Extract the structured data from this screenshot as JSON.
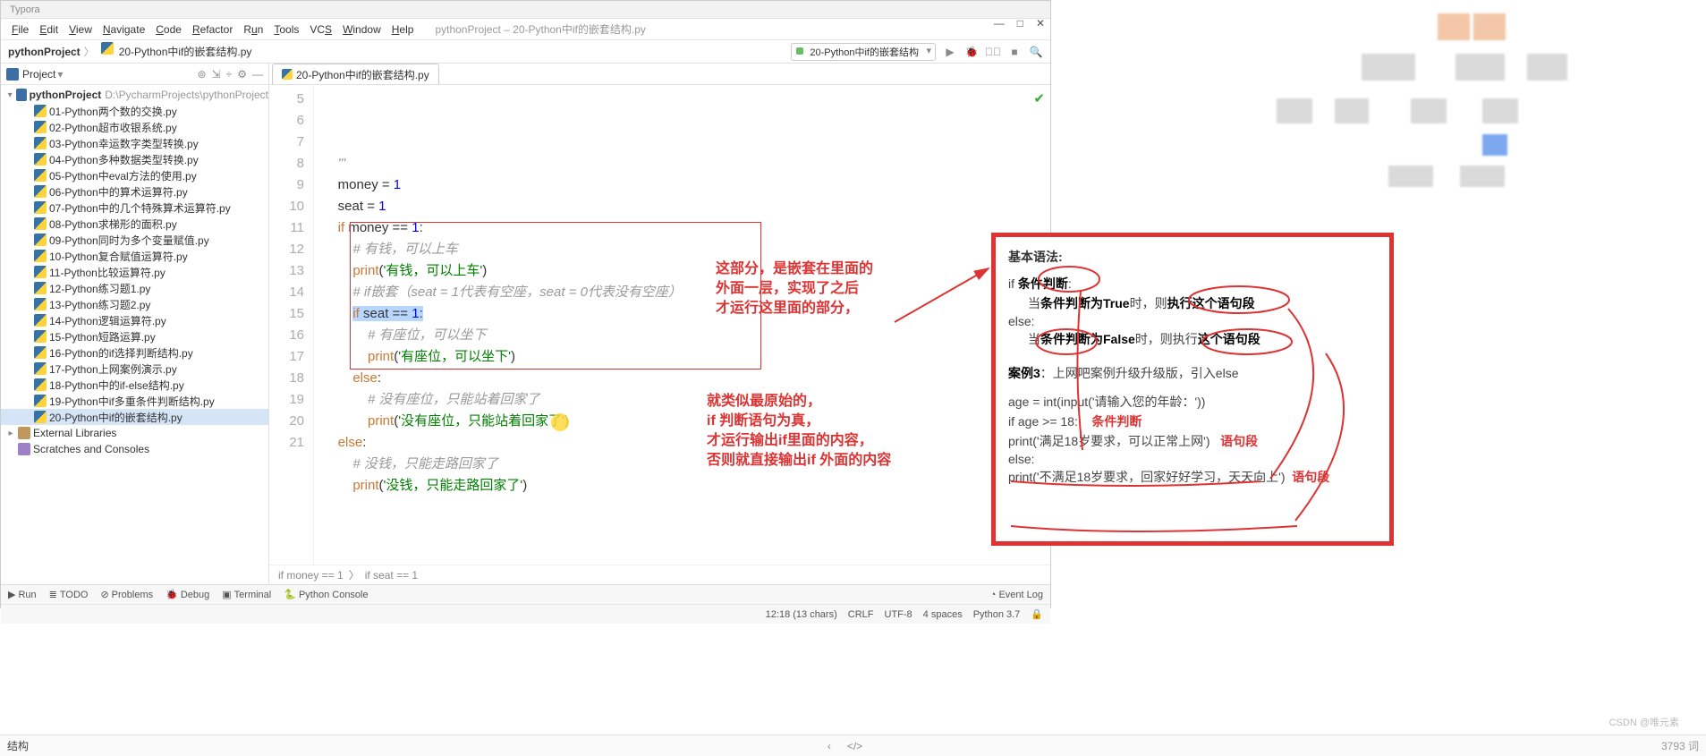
{
  "window": {
    "app_hint": "Typora",
    "title": "pythonProject – 20-Python中if的嵌套结构.py",
    "min": "—",
    "max": "□",
    "close": "✕"
  },
  "menu": [
    "File",
    "Edit",
    "View",
    "Navigate",
    "Code",
    "Refactor",
    "Run",
    "Tools",
    "VCS",
    "Window",
    "Help"
  ],
  "breadcrumb": {
    "project": "pythonProject",
    "file": "20-Python中if的嵌套结构.py"
  },
  "run_config": "20-Python中if的嵌套结构",
  "project_tool": {
    "title": "Project",
    "root": "pythonProject",
    "root_path": "D:\\PycharmProjects\\pythonProject",
    "files": [
      "01-Python两个数的交换.py",
      "02-Python超市收银系统.py",
      "03-Python幸运数字类型转换.py",
      "04-Python多种数据类型转换.py",
      "05-Python中eval方法的使用.py",
      "06-Python中的算术运算符.py",
      "07-Python中的几个特殊算术运算符.py",
      "08-Python求梯形的面积.py",
      "09-Python同时为多个变量赋值.py",
      "10-Python复合赋值运算符.py",
      "11-Python比较运算符.py",
      "12-Python练习题1.py",
      "13-Python练习题2.py",
      "14-Python逻辑运算符.py",
      "15-Python短路运算.py",
      "16-Python的if选择判断结构.py",
      "17-Python上网案例演示.py",
      "18-Python中的if-else结构.py",
      "19-Python中if多重条件判断结构.py",
      "20-Python中if的嵌套结构.py"
    ],
    "extras": [
      "External Libraries",
      "Scratches and Consoles"
    ],
    "selected_index": 19
  },
  "tab": {
    "label": "20-Python中if的嵌套结构.py"
  },
  "code": {
    "first_line_no": 5,
    "lines": [
      {
        "n": 5,
        "t": "    '''",
        "c": "cmt"
      },
      {
        "n": 6,
        "t": "    money = 1"
      },
      {
        "n": 7,
        "t": "    seat = 1"
      },
      {
        "n": 8,
        "t": "    if money == 1:"
      },
      {
        "n": 9,
        "t": "        # 有钱，可以上车",
        "c": "cmt"
      },
      {
        "n": 10,
        "t": "        print('有钱，可以上车')"
      },
      {
        "n": 11,
        "t": "        # if嵌套（seat = 1代表有空座，seat = 0代表没有空座）",
        "c": "cmt"
      },
      {
        "n": 12,
        "t": "        if seat == 1:",
        "hl": true,
        "sel": [
          8,
          22
        ]
      },
      {
        "n": 13,
        "t": "            # 有座位，可以坐下",
        "c": "cmt"
      },
      {
        "n": 14,
        "t": "            print('有座位，可以坐下')"
      },
      {
        "n": 15,
        "t": "        else:"
      },
      {
        "n": 16,
        "t": "            # 没有座位，只能站着回家了",
        "c": "cmt"
      },
      {
        "n": 17,
        "t": "            print('没有座位，只能站着回家了')"
      },
      {
        "n": 18,
        "t": "    else:"
      },
      {
        "n": 19,
        "t": "        # 没钱，只能走路回家了",
        "c": "cmt"
      },
      {
        "n": 20,
        "t": "        print('没钱，只能走路回家了')"
      },
      {
        "n": 21,
        "t": ""
      }
    ]
  },
  "crumbs": [
    "if money == 1",
    "if seat == 1"
  ],
  "status": {
    "left": [
      "Run",
      "TODO",
      "Problems",
      "Debug",
      "Terminal",
      "Python Console"
    ],
    "event_log": "Event Log",
    "pos": "12:18 (13 chars)",
    "eol": "CRLF",
    "enc": "UTF-8",
    "indent": "4 spaces",
    "python": "Python 3.7"
  },
  "anno": {
    "box1": [
      "这部分，是嵌套在里面的",
      "外面一层，实现了之后",
      "才运行这里面的部分，"
    ],
    "box2": [
      "就类似最原始的，",
      "if 判断语句为真，",
      "才运行输出if里面的内容，",
      "否则就直接输出if 外面的内容"
    ]
  },
  "right_card": {
    "header": "基本语法:",
    "if_prefix": "if",
    "cond_label": "条件判断",
    "true_line_a": "当",
    "true_line_b": "条件判断为True",
    "true_line_c": "时，则",
    "true_line_d": "执行这个语句段",
    "else_label": "else:",
    "false_line_a": "当",
    "false_line_b": "条件判断为False",
    "false_line_c": "时，则执行",
    "false_line_d": "这个语句段",
    "case_label": "案例3",
    "case_text": "：上网吧案例升级升级版，引入else",
    "code_l1": "age = int(input('请输入您的年龄：'))",
    "code_l2": "if age >= 18:",
    "code_l3": "    print('满足18岁要求，可以正常上网')",
    "code_l4": "else:",
    "code_l5": "    print('不满足18岁要求，回家好好学习，天天向上')",
    "red_cond": "条件判断",
    "red_seg": "语句段"
  },
  "bottom": {
    "left": "结构",
    "mid_l": "‹",
    "mid_code": "</>",
    "chars": "3793 词"
  },
  "watermark": "CSDN @唯元素"
}
